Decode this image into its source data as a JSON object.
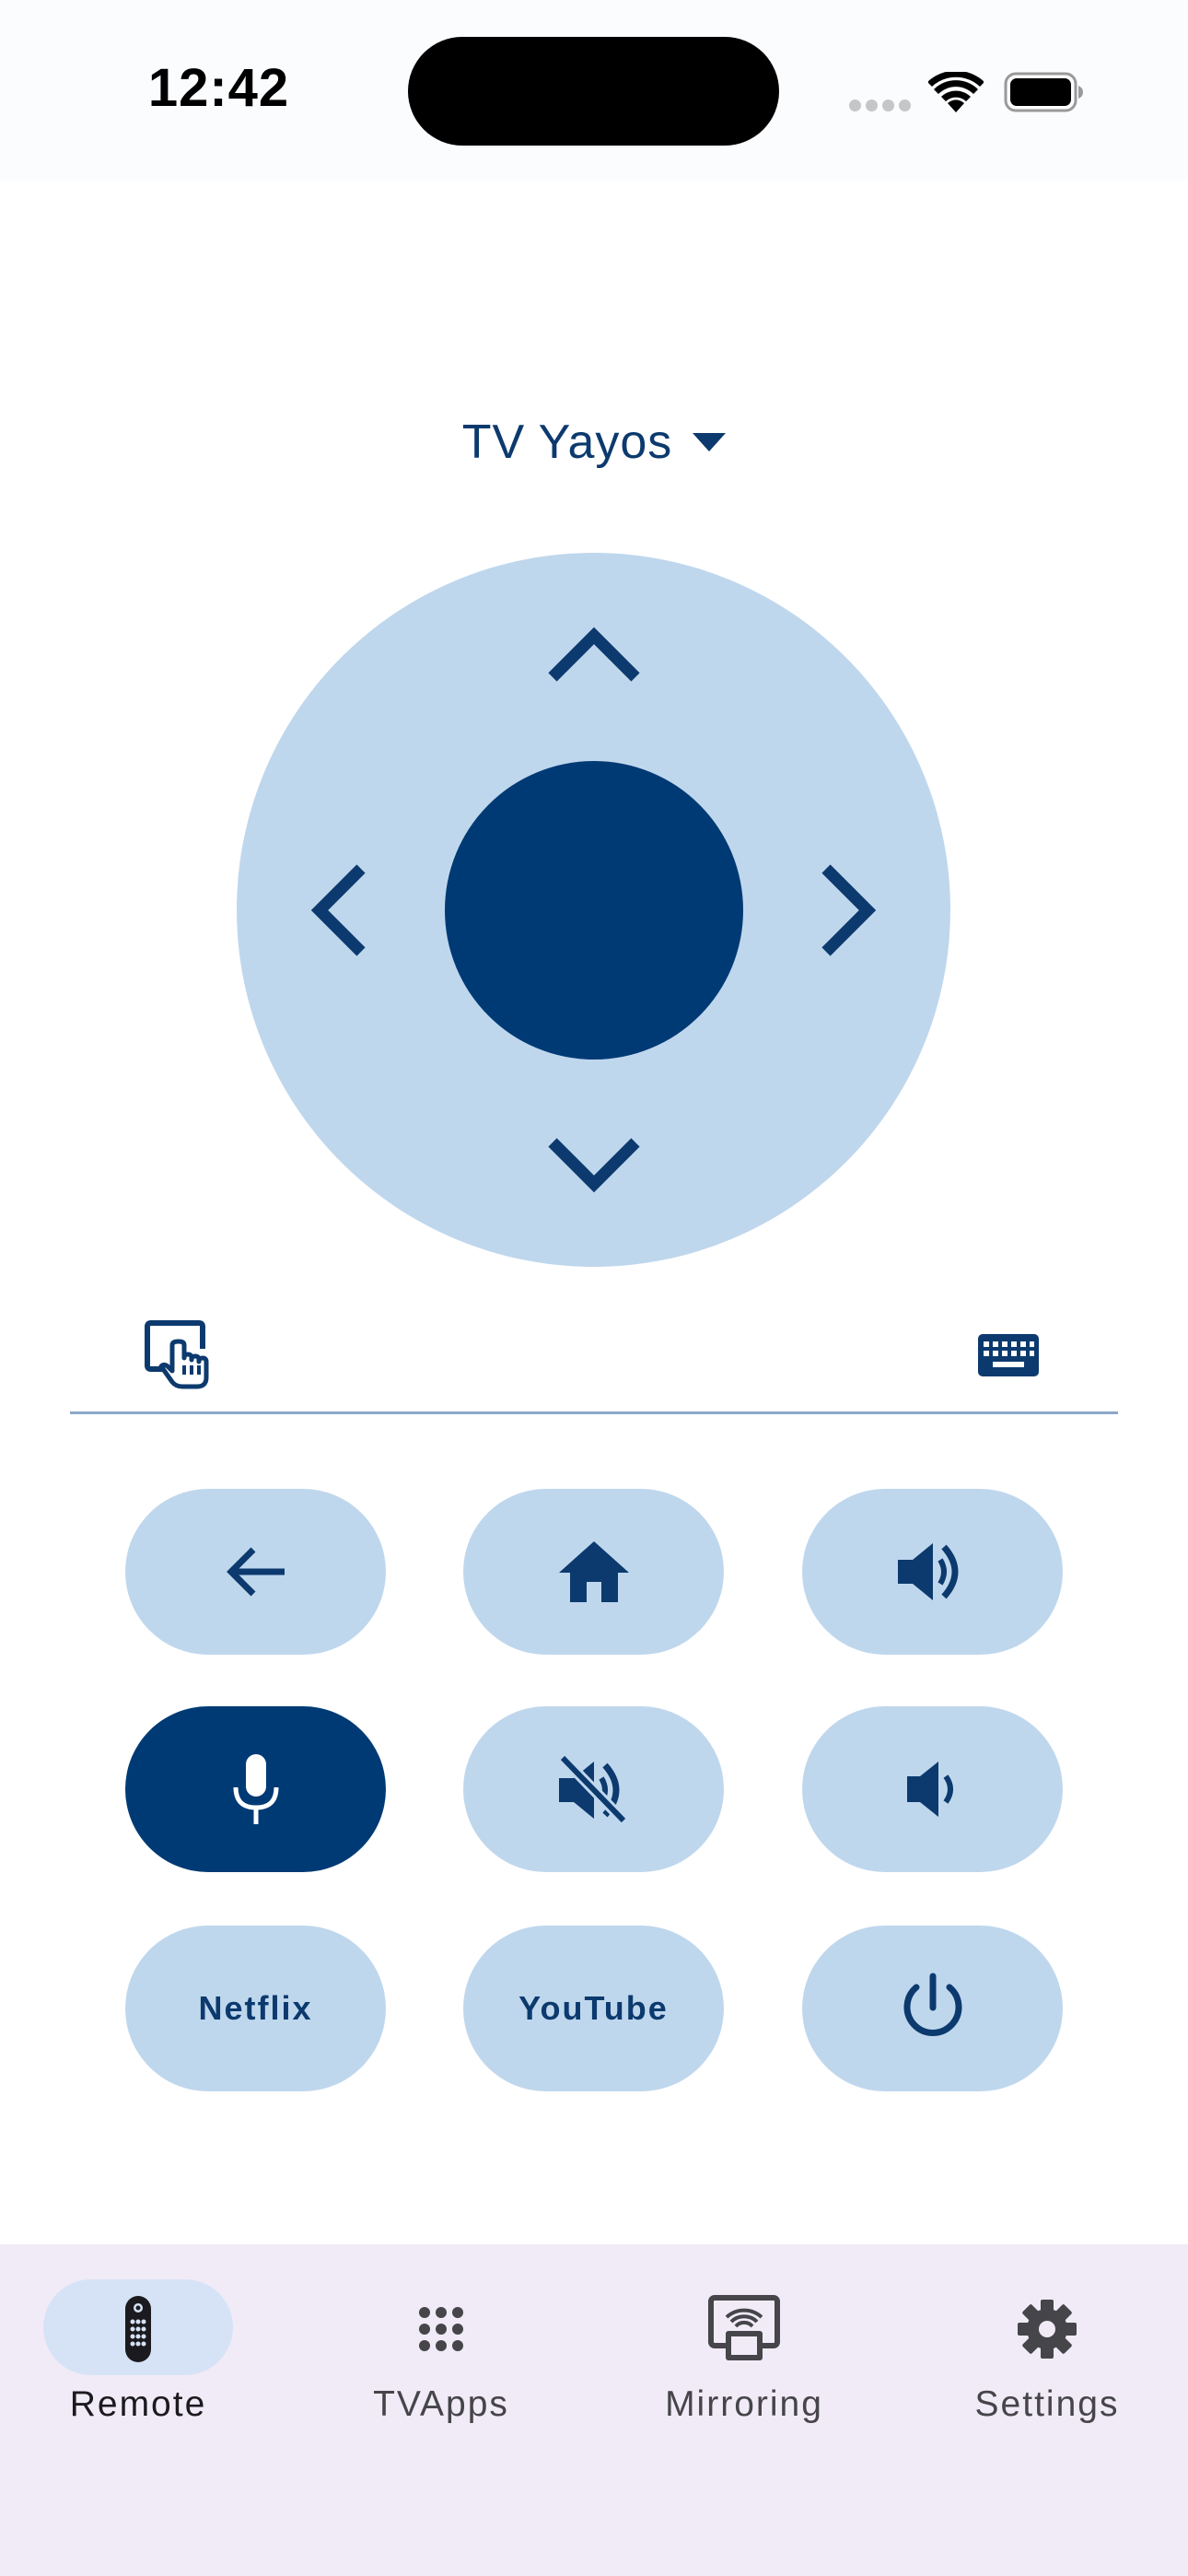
{
  "status_bar": {
    "time": "12:42",
    "icons": [
      "signal-dots-icon",
      "wifi-icon",
      "battery-icon"
    ]
  },
  "device_selector": {
    "name": "TV Yayos",
    "icon": "caret-down-icon"
  },
  "dpad": {
    "up_icon": "chevron-up-icon",
    "down_icon": "chevron-down-icon",
    "left_icon": "chevron-left-icon",
    "right_icon": "chevron-right-icon",
    "center_icon": "ok-button"
  },
  "tools": {
    "touchpad_icon": "touchpad-icon",
    "keyboard_icon": "keyboard-icon"
  },
  "buttons": {
    "back_icon": "back-arrow-icon",
    "home_icon": "home-icon",
    "volume_up_icon": "volume-up-icon",
    "mic_icon": "microphone-icon",
    "mute_icon": "volume-off-icon",
    "volume_down_icon": "volume-down-icon",
    "netflix_label": "Netflix",
    "youtube_label": "YouTube",
    "power_icon": "power-icon"
  },
  "bottom_nav": {
    "items": [
      {
        "label": "Remote",
        "icon": "remote-icon",
        "active": true
      },
      {
        "label": "TVApps",
        "icon": "grid-icon",
        "active": false
      },
      {
        "label": "Mirroring",
        "icon": "mirroring-icon",
        "active": false
      },
      {
        "label": "Settings",
        "icon": "gear-icon",
        "active": false
      }
    ]
  },
  "colors": {
    "primary": "#003a75",
    "primary_light": "#bfd7ed",
    "accent_text": "#0c3a6e",
    "nav_background": "#f1ebf7",
    "nav_active_pill": "#d6e3f6"
  }
}
